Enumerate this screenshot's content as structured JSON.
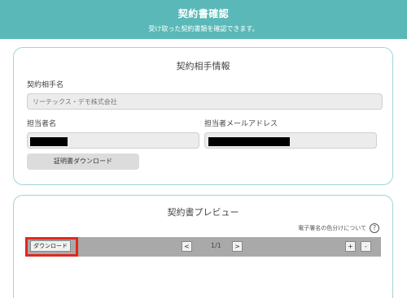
{
  "header": {
    "title": "契約書確認",
    "subtitle": "受け取った契約書類を確認できます。"
  },
  "contract_info": {
    "title": "契約相手情報",
    "partner_name_label": "契約相手名",
    "partner_name_value": "リーテックス・デモ株式会社",
    "person_label": "担当者名",
    "email_label": "担当者メールアドレス",
    "certificate_button": "証明書ダウンロード"
  },
  "preview": {
    "title": "契約書プレビュー",
    "help_text": "電子署名の色分けについて",
    "help_icon": "?",
    "download_button": "ダウンロード",
    "prev": "<",
    "page_indicator": "1/1",
    "next": ">",
    "zoom_in": "+",
    "zoom_out": "-"
  },
  "colors": {
    "header": "#5ab8b8",
    "card_border": "#9fd6d6",
    "highlight": "#e0281e"
  }
}
